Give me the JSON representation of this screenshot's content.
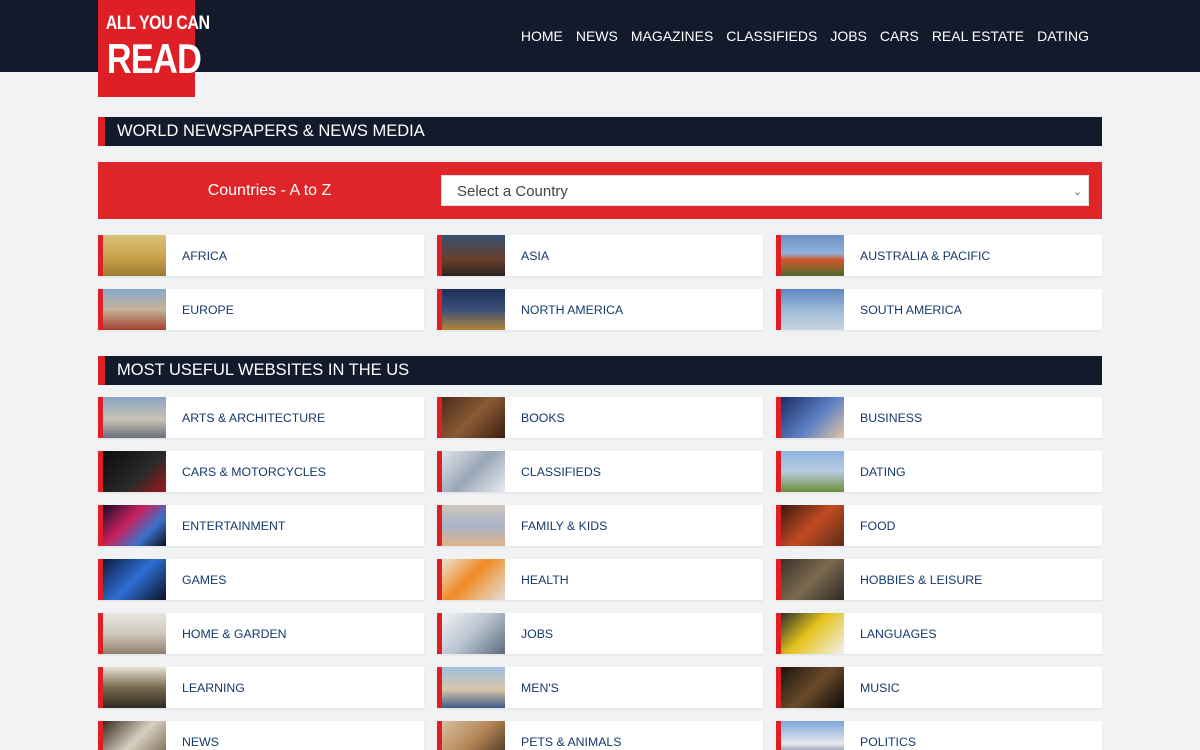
{
  "logo": {
    "line1": "ALL YOU CAN",
    "line2": "READ"
  },
  "nav": [
    "HOME",
    "NEWS",
    "MAGAZINES",
    "CLASSIFIEDS",
    "JOBS",
    "CARS",
    "REAL ESTATE",
    "DATING"
  ],
  "world_section": {
    "title": "WORLD NEWSPAPERS & NEWS MEDIA",
    "countries_label": "Countries - A to Z",
    "select_placeholder": "Select a Country",
    "regions": [
      "AFRICA",
      "ASIA",
      "AUSTRALIA & PACIFIC",
      "EUROPE",
      "NORTH AMERICA",
      "SOUTH AMERICA"
    ]
  },
  "us_section": {
    "title": "MOST USEFUL WEBSITES IN THE US",
    "categories": [
      "ARTS & ARCHITECTURE",
      "BOOKS",
      "BUSINESS",
      "CARS & MOTORCYCLES",
      "CLASSIFIEDS",
      "DATING",
      "ENTERTAINMENT",
      "FAMILY & KIDS",
      "FOOD",
      "GAMES",
      "HEALTH",
      "HOBBIES & LEISURE",
      "HOME & GARDEN",
      "JOBS",
      "LANGUAGES",
      "LEARNING",
      "MEN'S",
      "MUSIC",
      "NEWS",
      "PETS & ANIMALS",
      "POLITICS"
    ]
  },
  "colors": {
    "brand_red": "#df1f26",
    "navy": "#131a2c",
    "link_blue": "#143a6b",
    "page_bg": "#f1f2f4"
  }
}
